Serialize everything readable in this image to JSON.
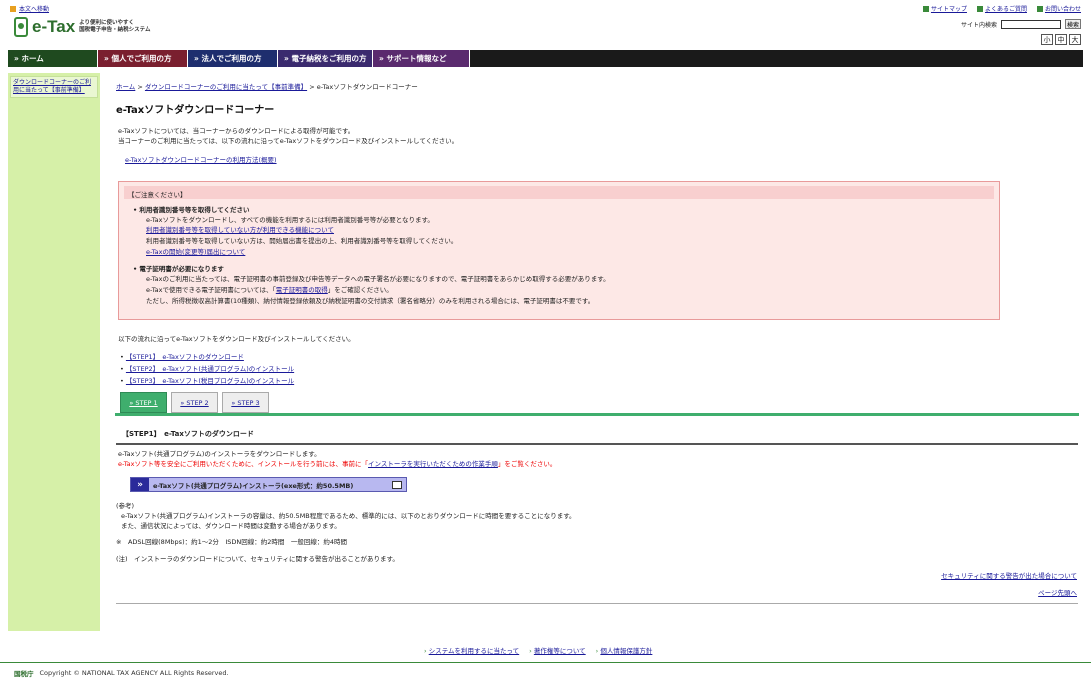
{
  "header": {
    "skip_link": "本文へ移動",
    "logo_text": "e-Tax",
    "tagline_1": "より便利に使いやすく",
    "tagline_2": "国税電子申告・納税システム",
    "top_links": [
      "サイトマップ",
      "よくあるご質問",
      "お問い合わせ"
    ],
    "search_label": "サイト内検索",
    "search_button": "検索",
    "font_sizes": [
      "小",
      "中",
      "大"
    ]
  },
  "nav": {
    "home": "» ホーム",
    "items": [
      "» 個人でご利用の方",
      "» 法人でご利用の方",
      "» 電子納税をご利用の方",
      "» サポート情報など"
    ]
  },
  "sidebar": {
    "items": [
      "ダウンロードコーナーのご利用に当たって【事前準備】"
    ]
  },
  "breadcrumb": {
    "home": "ホーム",
    "sep": ">",
    "parent": "ダウンロードコーナーのご利用に当たって【事前準備】",
    "current": "e-Taxソフトダウンロードコーナー"
  },
  "page": {
    "title": "e-Taxソフトダウンロードコーナー",
    "intro_1": "e-Taxソフトについては、当コーナーからのダウンロードによる取得が可能です。",
    "intro_2": "当コーナーのご利用に当たっては、以下の流れに沿ってe-Taxソフトをダウンロード及びインストールしてください。",
    "howto_link": "e-Taxソフトダウンロードコーナーの利用方法(概要)"
  },
  "notice": {
    "heading": "【ご注意ください】",
    "s1_title": "利用者識別番号等を取得してください",
    "s1_l1": "e-Taxソフトをダウンロードし、すべての機能を利用するには利用者識別番号等が必要となります。",
    "s1_link1": "利用者識別番号等を取得していない方が利用できる機能について",
    "s1_l2": "利用者識別番号等を取得していない方は、開始届出書を提出の上、利用者識別番号等を取得してください。",
    "s1_link2": "e-Taxの開始(変更等)届出について",
    "s2_title": "電子証明書が必要になります",
    "s2_l1": "e-Taxのご利用に当たっては、電子証明書の事前登録及び申告等データへの電子署名が必要になりますので、電子証明書をあらかじめ取得する必要があります。",
    "s2_l2_a": "e-Taxで使用できる電子証明書については、「",
    "s2_l2_link": "電子証明書の取得",
    "s2_l2_b": "」をご確認ください。",
    "s2_l3": "ただし、所得税徴収高計算書(10種類)、納付情報登録依頼及び納税証明書の交付請求（署名省略分）のみを利用される場合には、電子証明書は不要です。"
  },
  "flow": {
    "intro": "以下の流れに沿ってe-Taxソフトをダウンロード及びインストールしてください。",
    "steps": [
      "【STEP1】　e-Taxソフトのダウンロード",
      "【STEP2】　e-Taxソフト(共通プログラム)のインストール",
      "【STEP3】　e-Taxソフト(税目プログラム)のインストール"
    ],
    "tabs": [
      "» STEP 1",
      "» STEP 2",
      "» STEP 3"
    ]
  },
  "step1": {
    "heading": "【STEP1】　e-Taxソフトのダウンロード",
    "l1": "e-Taxソフト(共通プログラム)のインストーラをダウンロードします。",
    "l2_a": "e-Taxソフト等を安全にご利用いただくために、インストールを行う前には、事前に「",
    "l2_link": "インストーラを実行いただくための作業手順",
    "l2_b": "」をご覧ください。",
    "download_button": "e-Taxソフト(共通プログラム)インストーラ(exe形式：約50.5MB)",
    "ref_title": "(参考)",
    "ref_l1": "e-Taxソフト(共通プログラム)インストーラの容量は、約50.5MB程度であるため、標準的には、以下のとおりダウンロードに時間を要することになります。",
    "ref_l2": "また、通信状況によっては、ダウンロード時間は変動する場合があります。",
    "speed": "※　ADSL回線(8Mbps)：約1～2分　ISDN回線：約2時間　一般回線：約4時間",
    "note": "(注)　インストーラのダウンロードについて、セキュリティに関する警告が出ることがあります。",
    "security_link": "セキュリティに関する警告が出た場合について",
    "top_link": "ページ先頭へ"
  },
  "footer": {
    "links": [
      "システムを利用するに当たって",
      "著作権等について",
      "個人情報保護方針"
    ],
    "agency": "国税庁",
    "copyright": "Copyright © NATIONAL TAX AGENCY ALL Rights Reserved."
  }
}
